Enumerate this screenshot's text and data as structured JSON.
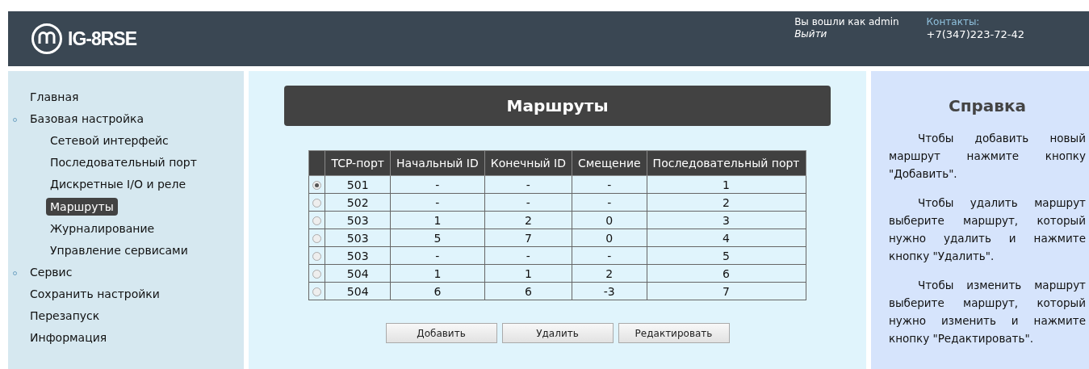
{
  "header": {
    "logo_text": "IG-8RSE",
    "login_text": "Вы вошли как admin",
    "logout_link": "Выйти",
    "contacts_label": "Контакты:",
    "contacts_phone": "+7(347)223-72-42"
  },
  "sidebar": {
    "items": [
      {
        "label": "Главная",
        "expandable": false,
        "selected": false
      },
      {
        "label": "Базовая настройка",
        "expandable": true,
        "selected": false,
        "children": [
          {
            "label": "Сетевой интерфейс",
            "selected": false
          },
          {
            "label": "Последовательный порт",
            "selected": false
          },
          {
            "label": "Дискретные I/O и реле",
            "selected": false
          },
          {
            "label": "Маршруты",
            "selected": true
          },
          {
            "label": "Журналирование",
            "selected": false
          },
          {
            "label": "Управление сервисами",
            "selected": false
          }
        ]
      },
      {
        "label": "Сервис",
        "expandable": true,
        "selected": false
      },
      {
        "label": "Сохранить настройки",
        "expandable": false,
        "selected": false
      },
      {
        "label": "Перезапуск",
        "expandable": false,
        "selected": false
      },
      {
        "label": "Информация",
        "expandable": false,
        "selected": false
      }
    ]
  },
  "main": {
    "title": "Маршруты",
    "table": {
      "columns": [
        "TCP-порт",
        "Начальный ID",
        "Конечный ID",
        "Смещение",
        "Последовательный порт"
      ],
      "rows": [
        {
          "selected": true,
          "cells": [
            "501",
            "-",
            "-",
            "-",
            "1"
          ]
        },
        {
          "selected": false,
          "cells": [
            "502",
            "-",
            "-",
            "-",
            "2"
          ]
        },
        {
          "selected": false,
          "cells": [
            "503",
            "1",
            "2",
            "0",
            "3"
          ]
        },
        {
          "selected": false,
          "cells": [
            "503",
            "5",
            "7",
            "0",
            "4"
          ]
        },
        {
          "selected": false,
          "cells": [
            "503",
            "-",
            "-",
            "-",
            "5"
          ]
        },
        {
          "selected": false,
          "cells": [
            "504",
            "1",
            "1",
            "2",
            "6"
          ]
        },
        {
          "selected": false,
          "cells": [
            "504",
            "6",
            "6",
            "-3",
            "7"
          ]
        }
      ]
    },
    "buttons": [
      "Добавить",
      "Удалить",
      "Редактировать"
    ]
  },
  "help": {
    "title": "Справка",
    "paragraphs": [
      "Чтобы добавить новый маршрут нажмите кнопку \"Добавить\".",
      "Чтобы удалить маршрут выберите маршрут, который нужно удалить и нажмите кнопку \"Удалить\".",
      "Чтобы изменить маршрут выберите маршрут, который нужно изменить и нажмите кнопку \"Редактировать\"."
    ]
  }
}
